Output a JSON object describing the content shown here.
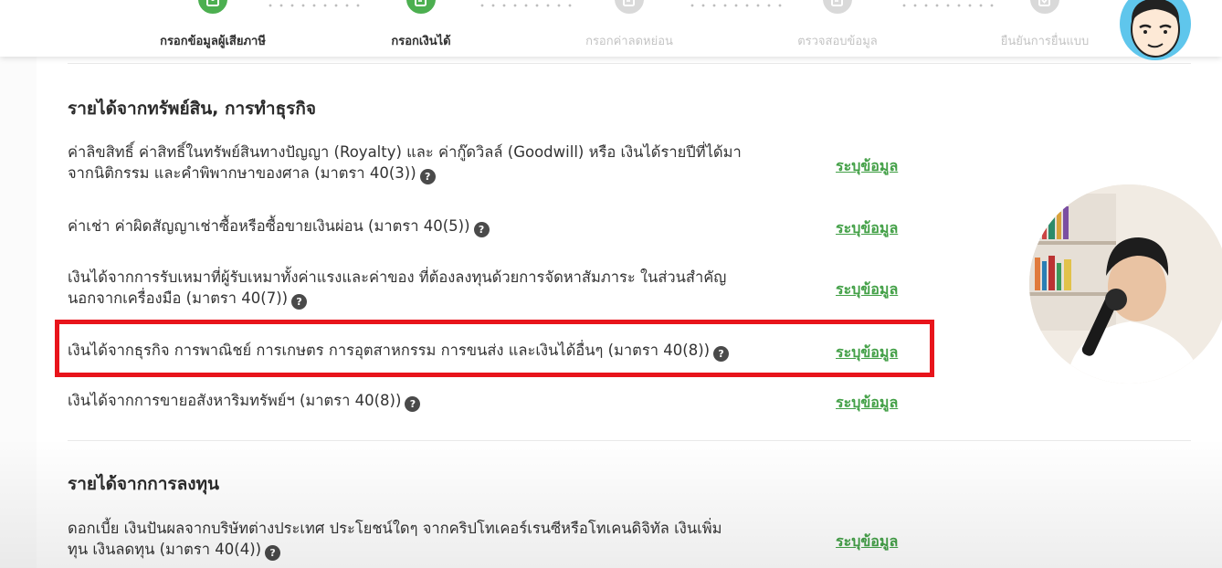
{
  "stepper": {
    "steps": [
      {
        "label": "กรอกข้อมูลผู้เสียภาษี",
        "state": "done",
        "icon": "person-card-icon"
      },
      {
        "label": "กรอกเงินได้",
        "state": "active",
        "icon": "form-edit-icon"
      },
      {
        "label": "กรอกค่าลดหย่อน",
        "state": "pending",
        "icon": "form-edit-icon"
      },
      {
        "label": "ตรวจสอบข้อมูล",
        "state": "pending",
        "icon": "form-edit-icon"
      },
      {
        "label": "ยืนยันการยื่นแบบ",
        "state": "pending",
        "icon": "form-check-icon"
      }
    ]
  },
  "sections": [
    {
      "title": "รายได้จากทรัพย์สิน, การทำธุรกิจ",
      "rows": [
        {
          "line1": "ค่าลิขสิทธิ์ ค่าสิทธิ์ในทรัพย์สินทางปัญญา (Royalty) และ ค่ากู๊ดวิลล์ (Goodwill) หรือ เงินได้รายปีที่ได้มา",
          "line2": "จากนิติกรรม และคำพิพากษาของศาล (มาตรา 40(3))",
          "action": "ระบุข้อมูล"
        },
        {
          "line1": "ค่าเช่า ค่าผิดสัญญาเช่าซื้อหรือซื้อขายเงินผ่อน (มาตรา 40(5))",
          "line2": "",
          "action": "ระบุข้อมูล"
        },
        {
          "line1": "เงินได้จากการรับเหมาที่ผู้รับเหมาทั้งค่าแรงและค่าของ ที่ต้องลงทุนด้วยการจัดหาสัมภาระ ในส่วนสำคัญ",
          "line2": "นอกจากเครื่องมือ (มาตรา 40(7))",
          "action": "ระบุข้อมูล"
        },
        {
          "line1": "เงินได้จากธุรกิจ การพาณิชย์ การเกษตร การอุตสาหกรรม การขนส่ง และเงินได้อื่นๆ (มาตรา 40(8))",
          "line2": "",
          "action": "ระบุข้อมูล",
          "highlighted": true
        },
        {
          "line1": "เงินได้จากการขายอสังหาริมทรัพย์ฯ (มาตรา 40(8))",
          "line2": "",
          "action": "ระบุข้อมูล"
        }
      ]
    },
    {
      "title": "รายได้จากการลงทุน",
      "rows": [
        {
          "line1": "ดอกเบี้ย เงินปันผลจากบริษัทต่างประเทศ ประโยชน์ใดๆ จากคริปโทเคอร์เรนซีหรือโทเคนดิจิทัล เงินเพิ่ม",
          "line2": "ทุน เงินลดทุน (มาตรา 40(4))",
          "action": "ระบุข้อมูล"
        }
      ]
    }
  ],
  "help_glyph": "?",
  "colors": {
    "active": "#4caf50",
    "link": "#43a047",
    "highlight": "#e8141b",
    "pending": "#d9d9d9"
  }
}
